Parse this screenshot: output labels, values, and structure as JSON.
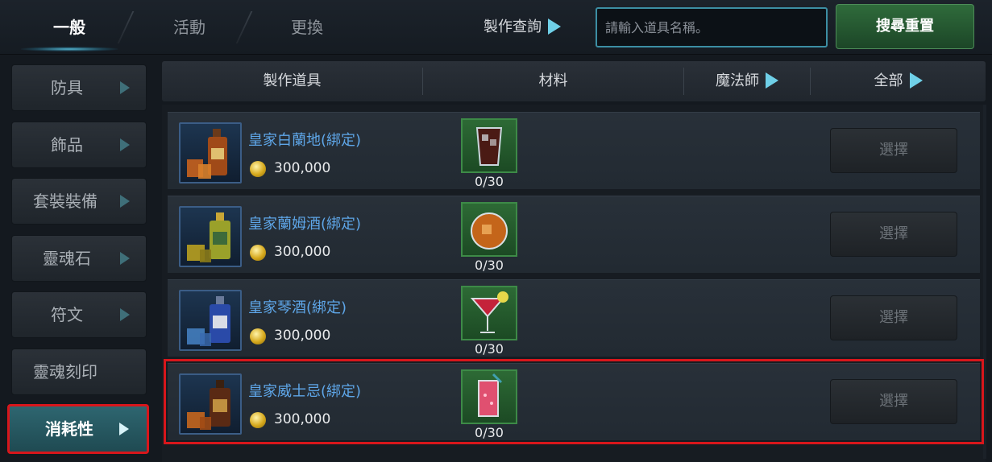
{
  "tabs": [
    {
      "label": "一般",
      "active": true
    },
    {
      "label": "活動",
      "active": false
    },
    {
      "label": "更換",
      "active": false
    }
  ],
  "search": {
    "craft_query_label": "製作查詢",
    "placeholder": "請輸入道具名稱。",
    "reset_label": "搜尋重置"
  },
  "sidebar": {
    "items": [
      {
        "label": "防具"
      },
      {
        "label": "飾品"
      },
      {
        "label": "套裝裝備"
      },
      {
        "label": "靈魂石"
      },
      {
        "label": "符文"
      },
      {
        "label": "靈魂刻印"
      },
      {
        "label": "消耗性",
        "active": true
      }
    ]
  },
  "table": {
    "headers": {
      "item": "製作道具",
      "material": "材料",
      "class_filter": "魔法師",
      "category_filter": "全部"
    },
    "rows": [
      {
        "name": "皇家白蘭地(綁定)",
        "price": "300,000",
        "material_count": "0/30",
        "button": "選擇",
        "icon": "brandy-bottle-icon",
        "material_icon": "cola-glass-icon"
      },
      {
        "name": "皇家蘭姆酒(綁定)",
        "price": "300,000",
        "material_count": "0/30",
        "button": "選擇",
        "icon": "rum-bottle-icon",
        "material_icon": "whiskey-ice-icon"
      },
      {
        "name": "皇家琴酒(綁定)",
        "price": "300,000",
        "material_count": "0/30",
        "button": "選擇",
        "icon": "gin-bottle-icon",
        "material_icon": "cocktail-glass-icon"
      },
      {
        "name": "皇家威士忌(綁定)",
        "price": "300,000",
        "material_count": "0/30",
        "button": "選擇",
        "icon": "whiskey-bottle-icon",
        "material_icon": "pink-drink-icon",
        "highlighted": true
      }
    ]
  },
  "colors": {
    "accent": "#6fd0e8",
    "highlight_border": "#d8161b",
    "item_name": "#5ea6e8",
    "reset_button": "#2f6b3b",
    "material_bg": "#2d6a35"
  }
}
